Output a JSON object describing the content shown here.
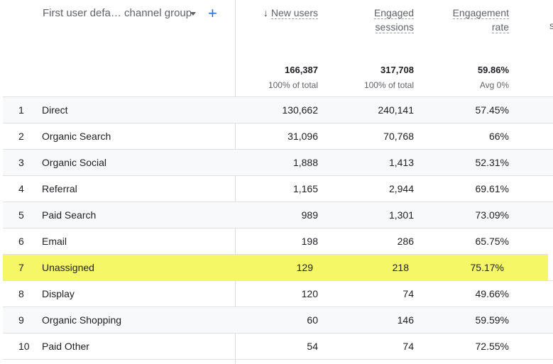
{
  "dimension": {
    "label": "First user defa… channel group",
    "add_icon": "plus-icon"
  },
  "columns": [
    {
      "label_lines": [
        "New users"
      ],
      "sorted": true,
      "total": "166,387",
      "sub": "100% of total"
    },
    {
      "label_lines": [
        "Engaged",
        "sessions"
      ],
      "sorted": false,
      "total": "317,708",
      "sub": "100% of total"
    },
    {
      "label_lines": [
        "Engagement",
        "rate"
      ],
      "sorted": false,
      "total": "59.86%",
      "sub": "Avg 0%"
    }
  ],
  "rows": [
    {
      "index": "1",
      "channel": "Direct",
      "new_users": "130,662",
      "engaged_sessions": "240,141",
      "engagement_rate": "57.45%"
    },
    {
      "index": "2",
      "channel": "Organic Search",
      "new_users": "31,096",
      "engaged_sessions": "70,768",
      "engagement_rate": "66%"
    },
    {
      "index": "3",
      "channel": "Organic Social",
      "new_users": "1,888",
      "engaged_sessions": "1,413",
      "engagement_rate": "52.31%"
    },
    {
      "index": "4",
      "channel": "Referral",
      "new_users": "1,165",
      "engaged_sessions": "2,944",
      "engagement_rate": "69.61%"
    },
    {
      "index": "5",
      "channel": "Paid Search",
      "new_users": "989",
      "engaged_sessions": "1,301",
      "engagement_rate": "73.09%"
    },
    {
      "index": "6",
      "channel": "Email",
      "new_users": "198",
      "engaged_sessions": "286",
      "engagement_rate": "65.75%"
    },
    {
      "index": "7",
      "channel": "Unassigned",
      "new_users": "129",
      "engaged_sessions": "218",
      "engagement_rate": "75.17%",
      "highlighted": true
    },
    {
      "index": "8",
      "channel": "Display",
      "new_users": "120",
      "engaged_sessions": "74",
      "engagement_rate": "49.66%"
    },
    {
      "index": "9",
      "channel": "Organic Shopping",
      "new_users": "60",
      "engaged_sessions": "146",
      "engagement_rate": "59.59%"
    },
    {
      "index": "10",
      "channel": "Paid Other",
      "new_users": "54",
      "engaged_sessions": "74",
      "engagement_rate": "72.55%"
    }
  ],
  "colors": {
    "highlight": "#f5f767",
    "accent": "#1a73e8"
  }
}
